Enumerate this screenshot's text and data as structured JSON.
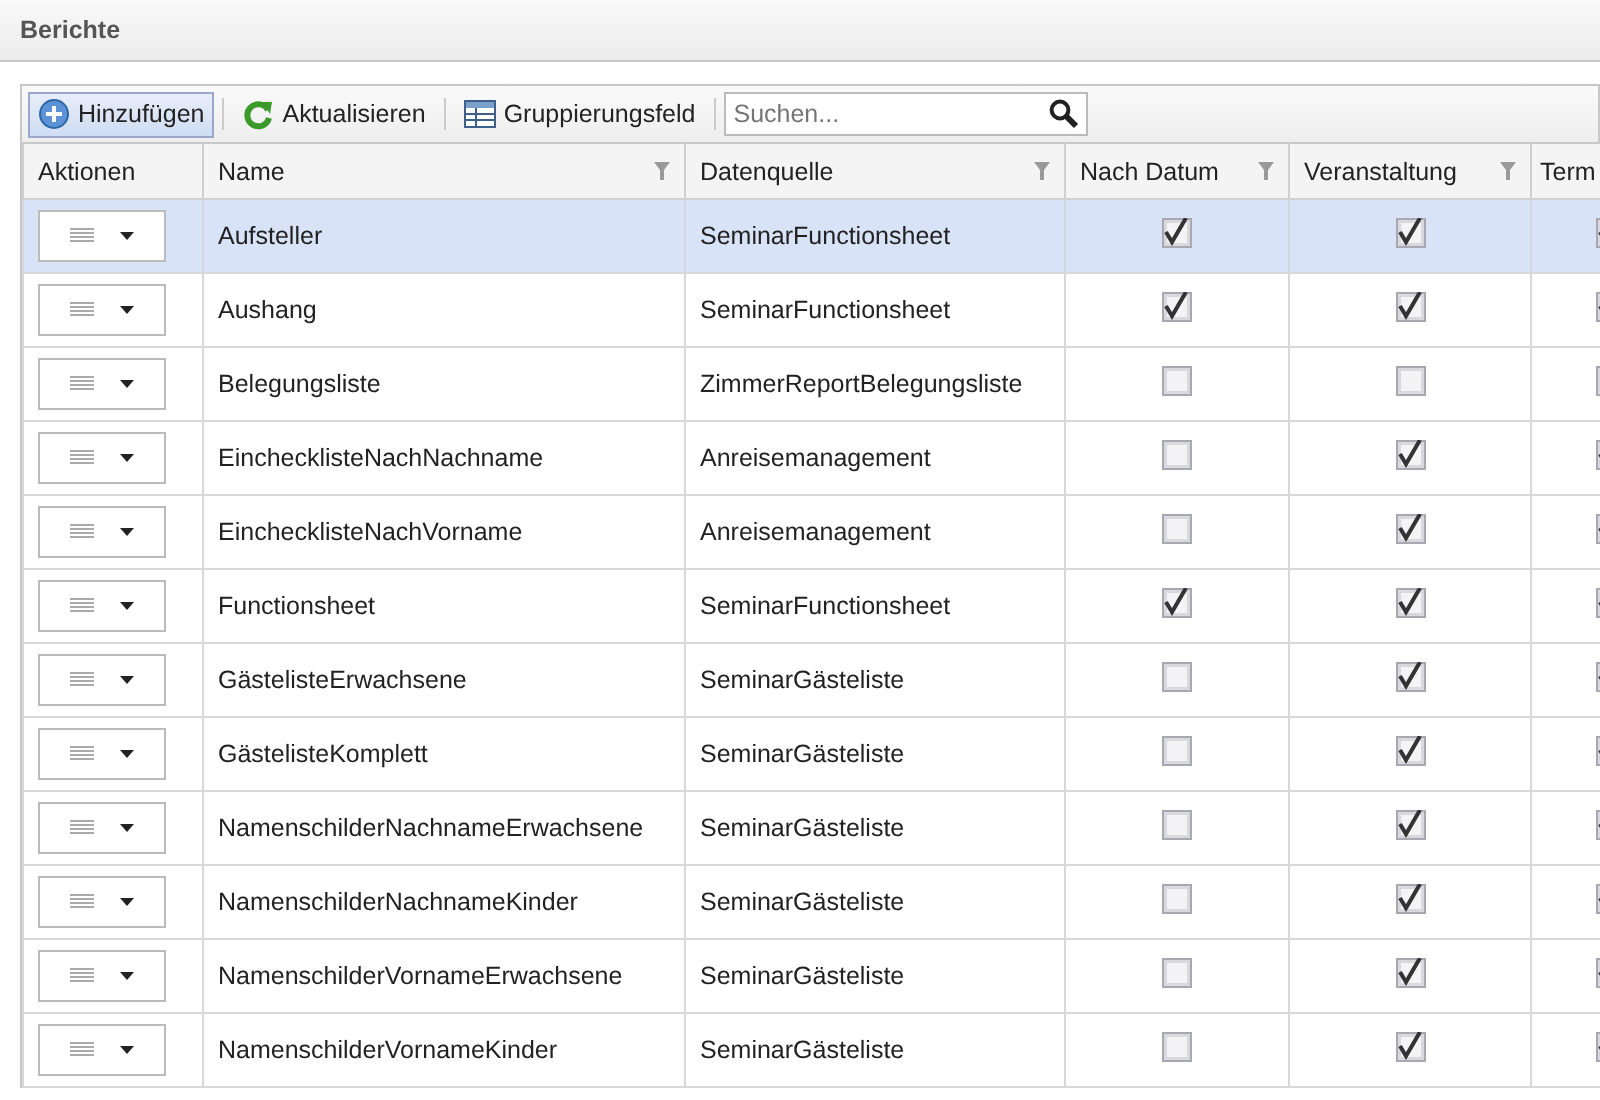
{
  "panel": {
    "title": "Berichte"
  },
  "toolbar": {
    "buttons": [
      {
        "label": "Hinzufügen",
        "kind": "add",
        "selected": true
      },
      {
        "label": "Aktualisieren",
        "kind": "refresh",
        "selected": false
      },
      {
        "label": "Gruppierungsfeld",
        "kind": "group",
        "selected": false
      }
    ],
    "search": {
      "placeholder": "Suchen..."
    }
  },
  "table": {
    "columns": [
      {
        "label": "Aktionen",
        "kind": "actions"
      },
      {
        "label": "Name",
        "kind": "text"
      },
      {
        "label": "Datenquelle",
        "kind": "text"
      },
      {
        "label": "Nach Datum",
        "kind": "check"
      },
      {
        "label": "Veranstaltung",
        "kind": "check"
      },
      {
        "label": "Term",
        "kind": "check"
      }
    ],
    "rows": [
      {
        "selected": true,
        "name": "Aufsteller",
        "source": "SeminarFunctionsheet",
        "checks": [
          true,
          true,
          true
        ]
      },
      {
        "selected": false,
        "name": "Aushang",
        "source": "SeminarFunctionsheet",
        "checks": [
          true,
          true,
          true
        ]
      },
      {
        "selected": false,
        "name": "Belegungsliste",
        "source": "ZimmerReportBelegungsliste",
        "checks": [
          false,
          false,
          false
        ]
      },
      {
        "selected": false,
        "name": "EinchecklisteNachNachname",
        "source": "Anreisemanagement",
        "checks": [
          false,
          true,
          true
        ]
      },
      {
        "selected": false,
        "name": "EinchecklisteNachVorname",
        "source": "Anreisemanagement",
        "checks": [
          false,
          true,
          true
        ]
      },
      {
        "selected": false,
        "name": "Functionsheet",
        "source": "SeminarFunctionsheet",
        "checks": [
          true,
          true,
          true
        ]
      },
      {
        "selected": false,
        "name": "GästelisteErwachsene",
        "source": "SeminarGästeliste",
        "checks": [
          false,
          true,
          true
        ]
      },
      {
        "selected": false,
        "name": "GästelisteKomplett",
        "source": "SeminarGästeliste",
        "checks": [
          false,
          true,
          true
        ]
      },
      {
        "selected": false,
        "name": "NamenschilderNachnameErwachsene",
        "source": "SeminarGästeliste",
        "checks": [
          false,
          true,
          true
        ]
      },
      {
        "selected": false,
        "name": "NamenschilderNachnameKinder",
        "source": "SeminarGästeliste",
        "checks": [
          false,
          true,
          true
        ]
      },
      {
        "selected": false,
        "name": "NamenschilderVornameErwachsene",
        "source": "SeminarGästeliste",
        "checks": [
          false,
          true,
          true
        ]
      },
      {
        "selected": false,
        "name": "NamenschilderVornameKinder",
        "source": "SeminarGästeliste",
        "checks": [
          false,
          true,
          true
        ]
      }
    ]
  }
}
